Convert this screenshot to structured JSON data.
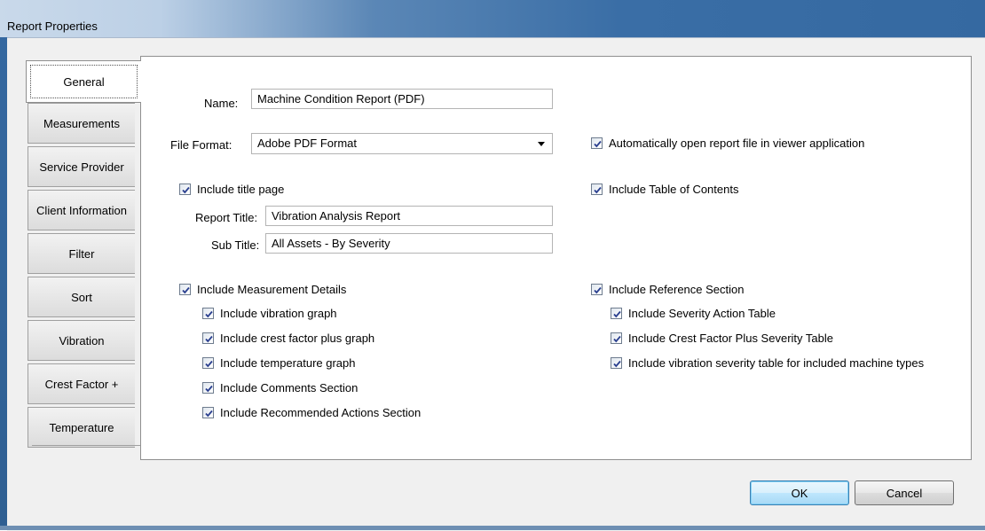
{
  "window": {
    "title": "Report Properties"
  },
  "tabs": [
    {
      "label": "General",
      "active": true
    },
    {
      "label": "Measurements",
      "active": false
    },
    {
      "label": "Service Provider",
      "active": false
    },
    {
      "label": "Client Information",
      "active": false
    },
    {
      "label": "Filter",
      "active": false
    },
    {
      "label": "Sort",
      "active": false
    },
    {
      "label": "Vibration",
      "active": false
    },
    {
      "label": "Crest Factor +",
      "active": false
    },
    {
      "label": "Temperature",
      "active": false
    }
  ],
  "general": {
    "name_label": "Name:",
    "name_value": "Machine Condition Report (PDF)",
    "file_format_label": "File Format:",
    "file_format_value": "Adobe PDF Format",
    "auto_open_label": "Automatically open report file in viewer application",
    "include_title_page_label": "Include title page",
    "include_toc_label": "Include Table of Contents",
    "report_title_label": "Report Title:",
    "report_title_value": "Vibration Analysis Report",
    "sub_title_label": "Sub Title:",
    "sub_title_value": "All Assets - By Severity",
    "measurement_details_label": "Include Measurement Details",
    "measurement_options": [
      "Include vibration graph",
      "Include crest factor plus graph",
      "Include temperature graph",
      "Include Comments Section",
      "Include Recommended Actions Section"
    ],
    "reference_section_label": "Include Reference Section",
    "reference_options": [
      "Include Severity Action Table",
      "Include Crest Factor Plus Severity Table",
      "Include vibration severity table for included machine types"
    ]
  },
  "buttons": {
    "ok": "OK",
    "cancel": "Cancel"
  }
}
